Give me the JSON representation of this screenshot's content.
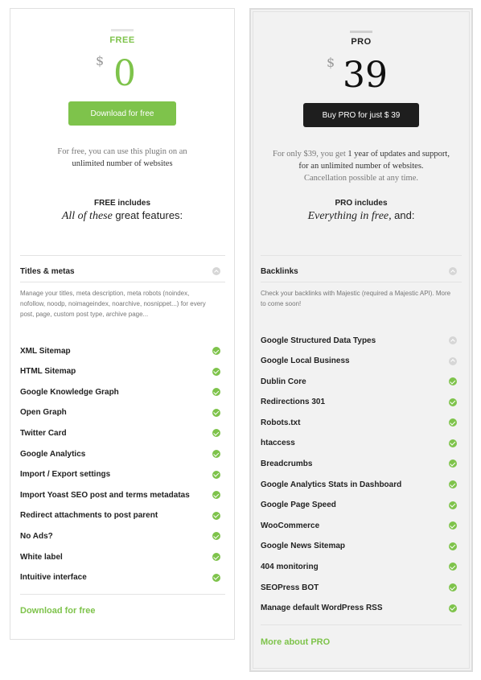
{
  "colors": {
    "accent": "#7ec34b",
    "dark_button": "#1e1e1e",
    "pro_background": "#f2f2f2"
  },
  "free": {
    "plan_name": "FREE",
    "currency": "$",
    "price": "0",
    "cta_label": "Download for free",
    "description_line1": "For free, you can use this plugin on an",
    "description_line2": "unlimited number of websites",
    "includes_title": "FREE includes",
    "includes_sub_italic": "All of these",
    "includes_sub_plain": "great features:",
    "expanded_feature": {
      "title": "Titles & metas",
      "description": "Manage your titles, meta description, meta robots (noindex, nofollow, noodp, noimageindex, noarchive, nosnippet...) for every post, page, custom post type, archive page..."
    },
    "features": [
      "XML Sitemap",
      "HTML Sitemap",
      "Google Knowledge Graph",
      "Open Graph",
      "Twitter Card",
      "Google Analytics",
      "Import / Export settings",
      "Import Yoast SEO post and terms metadatas",
      "Redirect attachments to post parent",
      "No Ads?",
      "White label",
      "Intuitive interface"
    ],
    "footer_link": "Download for free"
  },
  "pro": {
    "plan_name": "PRO",
    "currency": "$",
    "price": "39",
    "cta_label": "Buy PRO for just $ 39",
    "description_line1a": "For only $39, you get",
    "description_line1b": "1 year of updates and support,",
    "description_line2": "for an unlimited number of websites.",
    "description_line3": "Cancellation possible at any time.",
    "includes_title": "PRO includes",
    "includes_sub_italic": "Everything in free,",
    "includes_sub_plain": "and:",
    "expanded_feature": {
      "title": "Backlinks",
      "description": "Check your backlinks with Majestic (required a Majestic API). More to come soon!"
    },
    "features_collapsed": [
      "Google Structured Data Types",
      "Google Local Business"
    ],
    "features": [
      "Dublin Core",
      "Redirections 301",
      "Robots.txt",
      "htaccess",
      "Breadcrumbs",
      "Google Analytics Stats in Dashboard",
      "Google Page Speed",
      "WooCommerce",
      "Google News Sitemap",
      "404 monitoring",
      "SEOPress BOT",
      "Manage default WordPress RSS"
    ],
    "footer_link": "More about PRO"
  }
}
